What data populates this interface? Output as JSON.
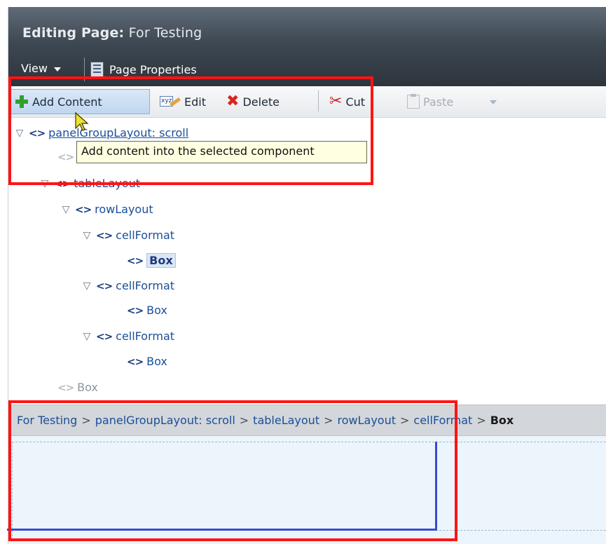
{
  "header": {
    "title_prefix": "Editing Page:",
    "title_name": "For Testing",
    "menu": {
      "view_label": "View",
      "page_properties_label": "Page Properties"
    }
  },
  "toolbar": {
    "add_content_label": "Add Content",
    "edit_label": "Edit",
    "delete_label": "Delete",
    "cut_label": "Cut",
    "paste_label": "Paste"
  },
  "tooltip": {
    "text": "Add content into the selected component"
  },
  "tree": {
    "nodes": [
      {
        "label": "panelGroupLayout: scroll",
        "expanded": true
      },
      {
        "label": "tableLayout",
        "expanded": true
      },
      {
        "label": "rowLayout",
        "expanded": true
      },
      {
        "label": "cellFormat",
        "expanded": true
      },
      {
        "label": "Box",
        "selected": true
      },
      {
        "label": "cellFormat",
        "expanded": true
      },
      {
        "label": "Box"
      },
      {
        "label": "cellFormat",
        "expanded": true
      },
      {
        "label": "Box"
      },
      {
        "label": "Box",
        "disabled": true
      }
    ]
  },
  "breadcrumb": {
    "items": [
      "For Testing",
      "panelGroupLayout: scroll",
      "tableLayout",
      "rowLayout",
      "cellFormat"
    ],
    "current": "Box",
    "separator": ">"
  },
  "colors": {
    "header_dark": "#2d343c",
    "highlight_red": "#ff1414",
    "link_blue": "#1a4f99",
    "tooltip_bg": "#ffffe1",
    "preview_bg": "#ebf5fb",
    "selection_border": "#3a49d6"
  },
  "icons": {
    "add": "plus-icon",
    "edit": "edit-xyz-icon",
    "delete": "x-delete-icon",
    "cut": "scissors-icon",
    "paste": "clipboard-icon",
    "tree_node": "code-brackets-icon",
    "page_properties": "document-icon"
  }
}
